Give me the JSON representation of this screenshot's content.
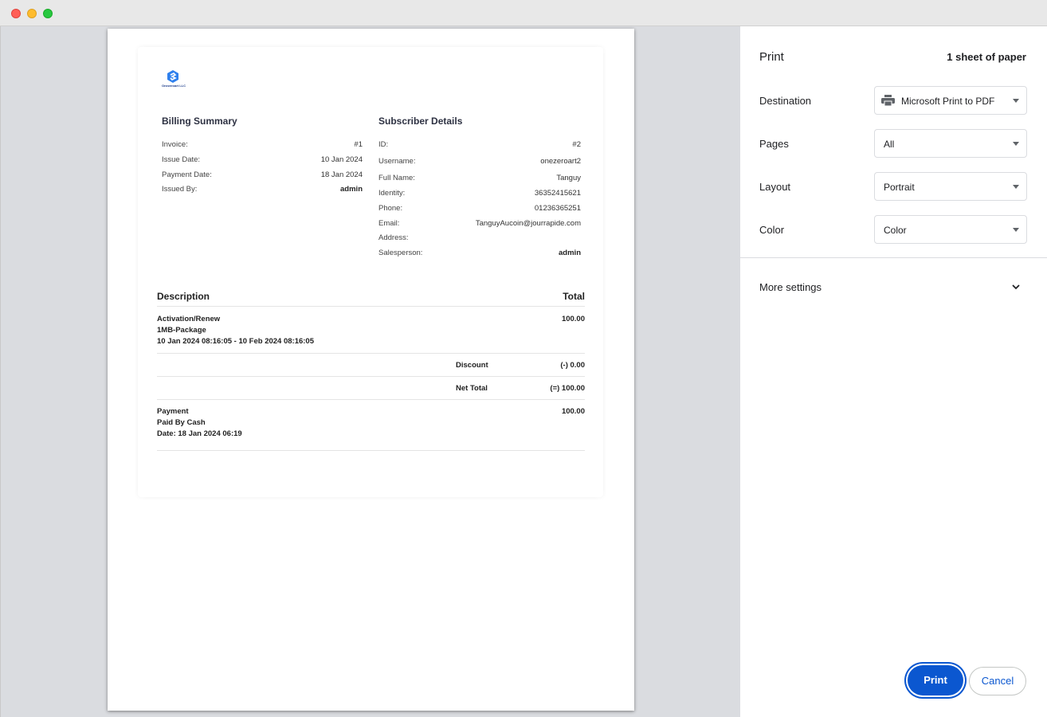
{
  "window": {
    "controls": [
      "close",
      "minimize",
      "maximize"
    ]
  },
  "invoice": {
    "logo_text": "Onezeroart LLC",
    "billing": {
      "heading": "Billing Summary",
      "rows": [
        {
          "label": "Invoice:",
          "value": "#1"
        },
        {
          "label": "Issue Date:",
          "value": "10 Jan 2024"
        },
        {
          "label": "Payment Date:",
          "value": "18 Jan 2024"
        },
        {
          "label": "Issued By:",
          "value": "admin"
        }
      ]
    },
    "subscriber": {
      "heading": "Subscriber Details",
      "rows": [
        {
          "label": "ID:",
          "value": "#2"
        },
        {
          "label": "Username:",
          "value": "onezeroart2"
        },
        {
          "label": "Full Name:",
          "value": "Tanguy"
        },
        {
          "label": "Identity:",
          "value": "36352415621"
        },
        {
          "label": "Phone:",
          "value": "01236365251"
        },
        {
          "label": "Email:",
          "value": "TanguyAucoin@jourrapide.com"
        },
        {
          "label": "Address:",
          "value": ""
        },
        {
          "label": "Salesperson:",
          "value": "admin"
        }
      ]
    },
    "table": {
      "col_description": "Description",
      "col_total": "Total",
      "item": {
        "line1": "Activation/Renew",
        "line2": "1MB-Package",
        "line3": "10 Jan 2024 08:16:05 - 10 Feb 2024 08:16:05",
        "total": "100.00"
      },
      "discount_label": "Discount",
      "discount_value": "(-) 0.00",
      "net_total_label": "Net Total",
      "net_total_value": "(=) 100.00",
      "payment": {
        "line1": "Payment",
        "line2": "Paid By Cash",
        "line3": "Date: 18 Jan 2024 06:19",
        "total": "100.00"
      }
    }
  },
  "print_panel": {
    "title": "Print",
    "sheets": "1 sheet of paper",
    "destination_label": "Destination",
    "destination_value": "Microsoft Print to PDF",
    "pages_label": "Pages",
    "pages_value": "All",
    "layout_label": "Layout",
    "layout_value": "Portrait",
    "color_label": "Color",
    "color_value": "Color",
    "more_settings": "More settings",
    "print_button": "Print",
    "cancel_button": "Cancel"
  },
  "colors": {
    "accent": "#0b57d0",
    "logo": "#2f80ed"
  },
  "icons": [
    "printer-icon",
    "chevron-down-icon",
    "caret-down-icon",
    "logo-icon"
  ]
}
